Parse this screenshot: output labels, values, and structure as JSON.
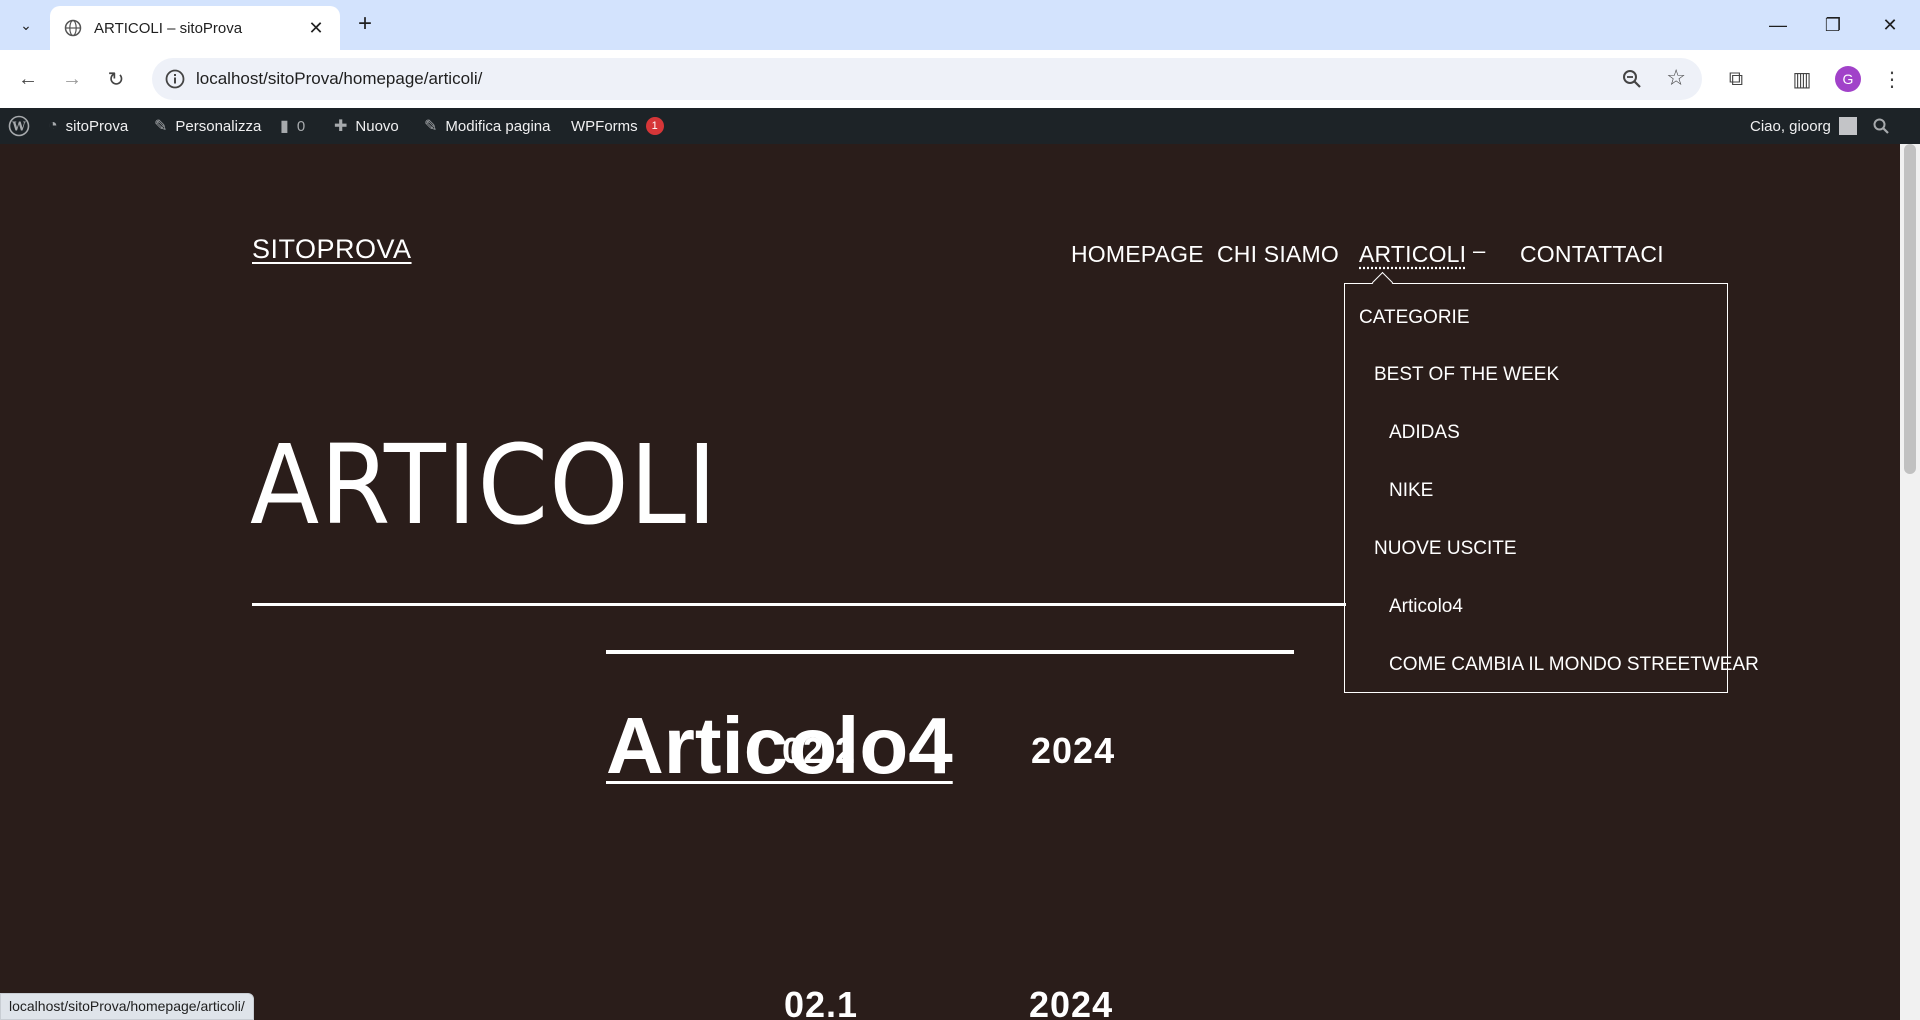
{
  "browser": {
    "tab_title": "ARTICOLI – sitoProva",
    "url": "localhost/sitoProva/homepage/articoli/",
    "profile_initial": "G",
    "status_url": "localhost/sitoProva/homepage/articoli/"
  },
  "adminbar": {
    "site_name": "sitoProva",
    "customize": "Personalizza",
    "comments_count": "0",
    "new": "Nuovo",
    "edit_page": "Modifica pagina",
    "wpforms": "WPForms",
    "wpforms_badge": "1",
    "greeting": "Ciao, gioorg"
  },
  "site": {
    "title": "SITOPROVA",
    "nav": {
      "homepage": "HOMEPAGE",
      "chi_siamo": "CHI SIAMO",
      "articoli": "ARTICOLI",
      "dash": "–",
      "contattaci": "CONTATTACI"
    },
    "dropdown": {
      "categorie": "CATEGORIE",
      "best_of_week": "BEST OF THE WEEK",
      "adidas": "ADIDAS",
      "nike": "NIKE",
      "nuove_uscite": "NUOVE USCITE",
      "articolo4": "Articolo4",
      "streetwear": "COME CAMBIA IL MONDO STREETWEAR"
    },
    "page_title": "ARTICOLI",
    "posts": [
      {
        "day_month": "02.2",
        "year": "2024",
        "title": "Articolo4"
      },
      {
        "day_month": "02.1",
        "year": "2024"
      }
    ]
  },
  "colors": {
    "site_background": "#2a1d1a",
    "adminbar": "#1d2327",
    "tabstrip": "#d3e3fd"
  }
}
